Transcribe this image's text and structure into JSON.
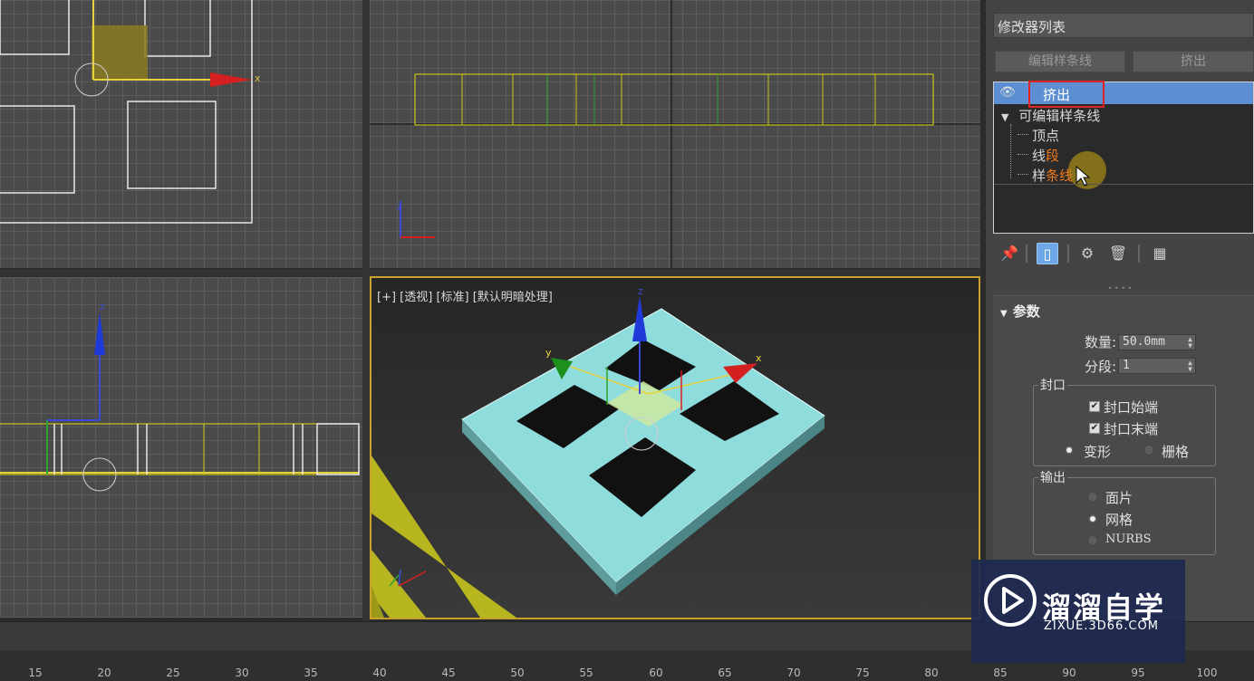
{
  "viewports": {
    "perspective_label": "[+] [透视] [标准] [默认明暗处理]"
  },
  "axes": {
    "x": "x",
    "y": "y",
    "z": "z"
  },
  "modifier_panel": {
    "list_label": "修改器列表",
    "buttons": [
      "编辑样条线",
      "挤出"
    ],
    "stack": {
      "top": {
        "label": "挤出",
        "icon": "eye-icon"
      },
      "base": "可编辑样条线",
      "sub_items": [
        {
          "prefix": "",
          "highlight": "顶点"
        },
        {
          "prefix": "线",
          "highlight": "段"
        },
        {
          "prefix": "样",
          "highlight": "条线"
        }
      ]
    },
    "toolbar_icons": [
      "pin-icon",
      "show-end-result-icon",
      "make-unique-icon",
      "remove-modifier-icon",
      "configure-icon"
    ]
  },
  "parameters": {
    "title": "参数",
    "amount": {
      "label": "数量:",
      "value": "50.0mm"
    },
    "segments": {
      "label": "分段:",
      "value": "1"
    },
    "capping": {
      "title": "封口",
      "cap_start": {
        "label": "封口始端",
        "checked": true
      },
      "cap_end": {
        "label": "封口末端",
        "checked": true
      },
      "morph": {
        "label": "变形",
        "selected": true
      },
      "grid": {
        "label": "栅格",
        "selected": false
      }
    },
    "output": {
      "title": "输出",
      "options": [
        {
          "label": "面片",
          "selected": false
        },
        {
          "label": "网格",
          "selected": true
        },
        {
          "label": "NURBS",
          "selected": false
        }
      ]
    }
  },
  "timeline": {
    "ticks": [
      "15",
      "20",
      "25",
      "30",
      "35",
      "40",
      "45",
      "50",
      "55",
      "60",
      "65",
      "70",
      "75",
      "80",
      "85",
      "90",
      "95",
      "100"
    ]
  },
  "watermark": {
    "title": "溜溜自学",
    "subtitle": "ZIXUE.3D66.COM"
  },
  "colors": {
    "accent": "#5b8fd1",
    "highlight_box": "#e02424",
    "selection_border": "#c8a22a",
    "object": "#8fdcdc"
  }
}
